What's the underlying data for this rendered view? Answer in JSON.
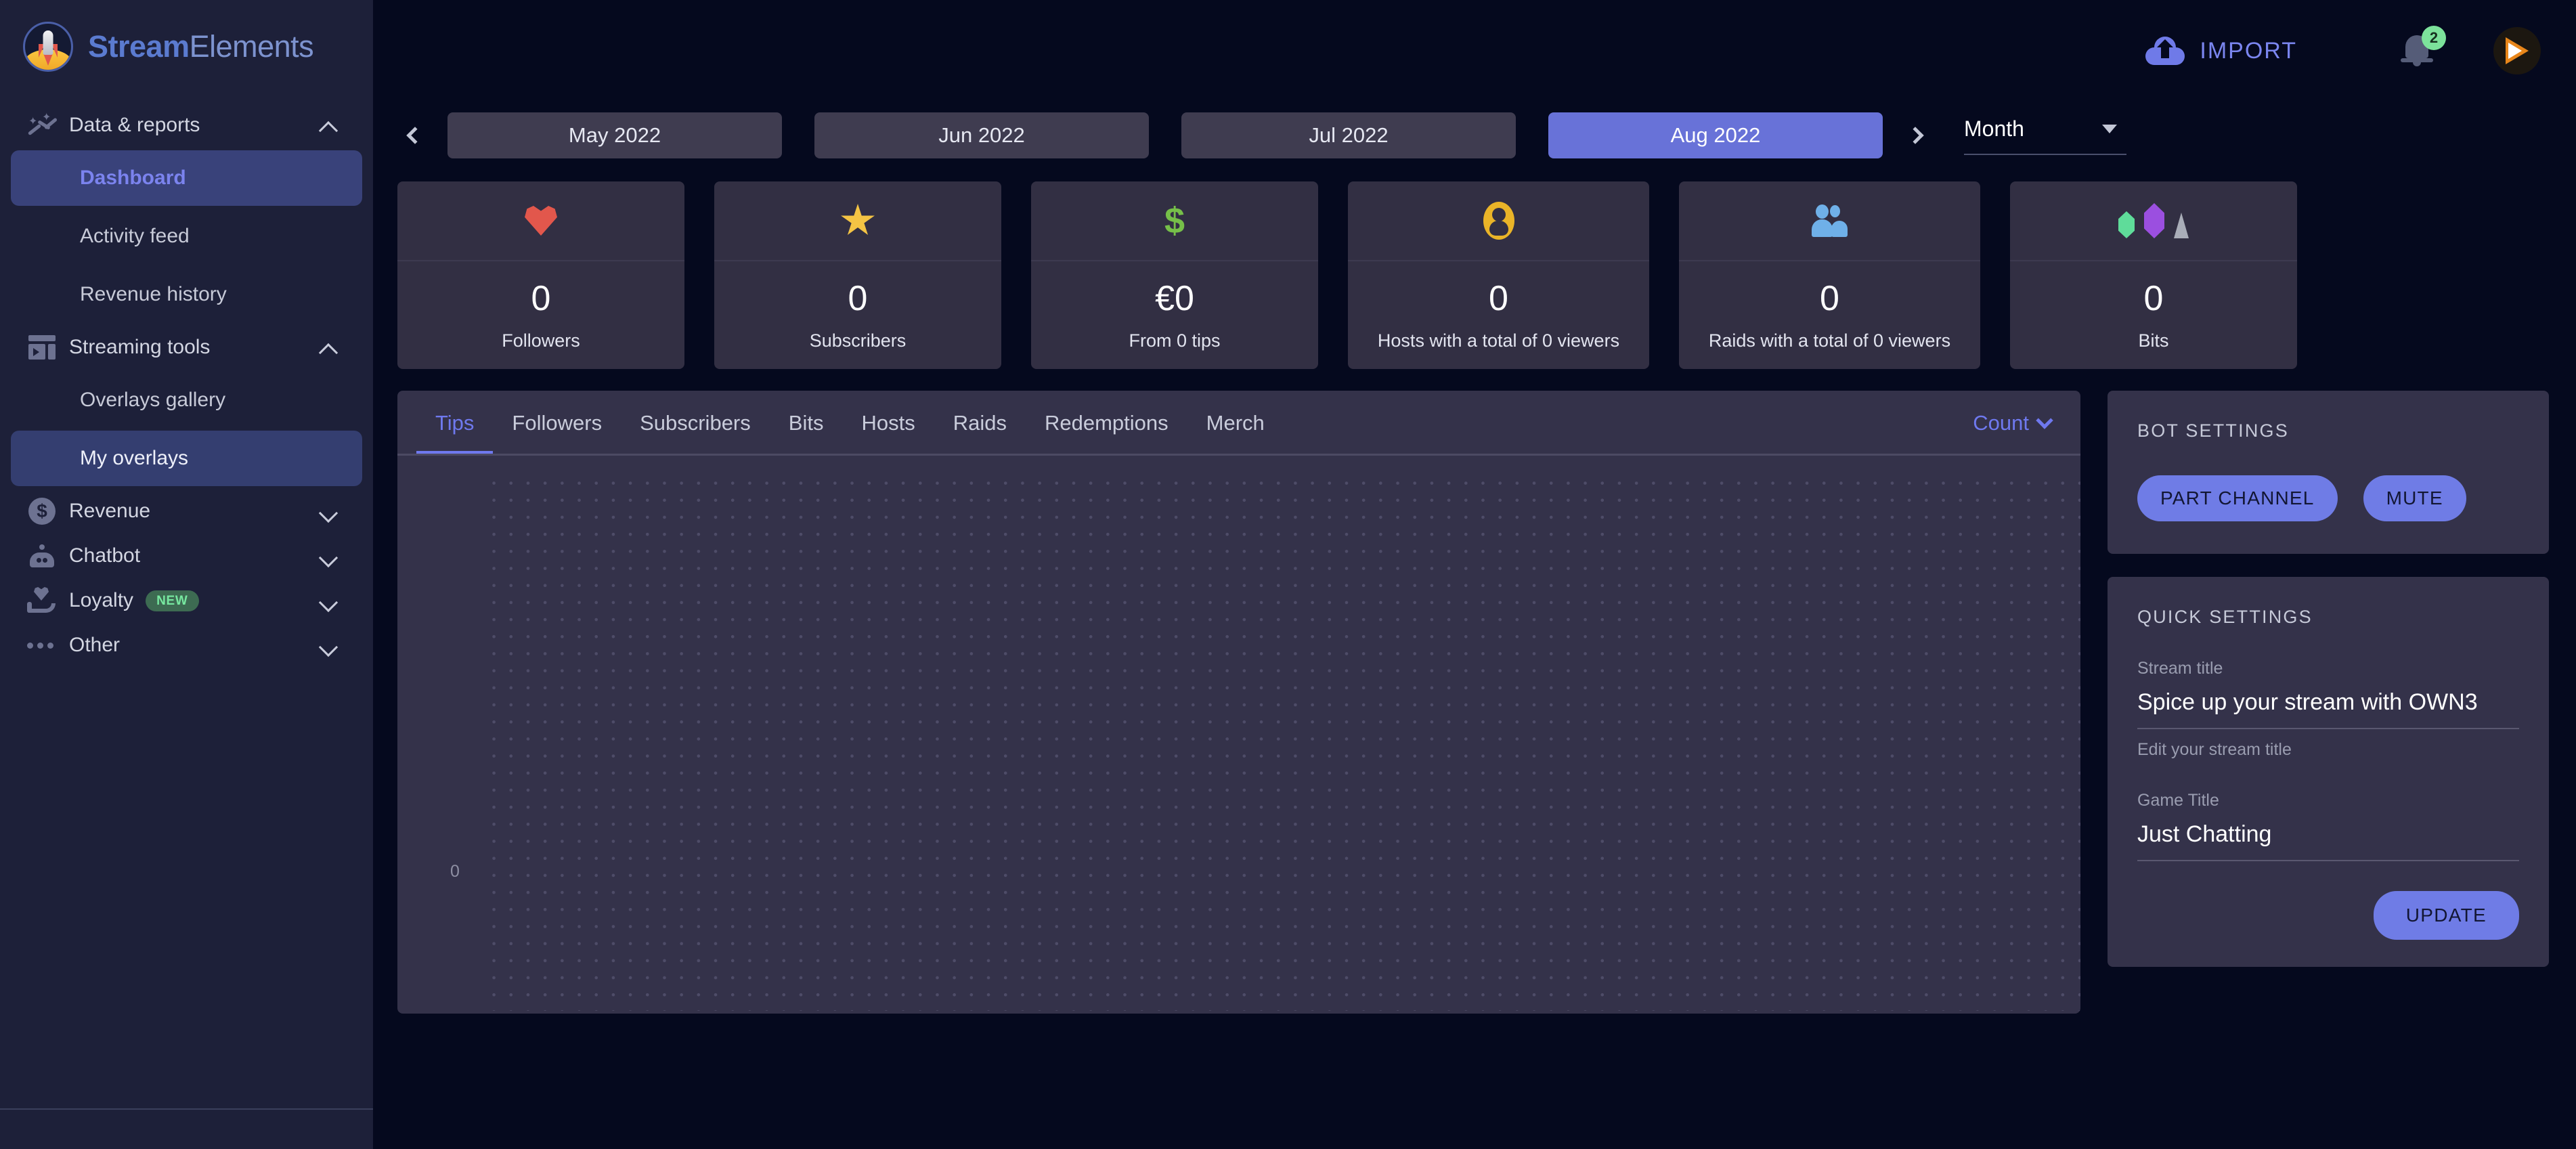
{
  "brand": {
    "name_bold": "Stream",
    "name_light": "Elements"
  },
  "topbar": {
    "import_label": "IMPORT",
    "notification_count": "2"
  },
  "sidebar": {
    "groups": [
      {
        "label": "Data & reports",
        "icon": "trend-icon",
        "expanded": true
      },
      {
        "label": "Streaming tools",
        "icon": "panel-icon",
        "expanded": true
      },
      {
        "label": "Revenue",
        "icon": "dollar-circle-icon",
        "expanded": false
      },
      {
        "label": "Chatbot",
        "icon": "robot-icon",
        "expanded": false
      },
      {
        "label": "Loyalty",
        "icon": "hand-heart-icon",
        "expanded": false,
        "badge": "NEW"
      },
      {
        "label": "Other",
        "icon": "ellipsis-icon",
        "expanded": false
      }
    ],
    "items": {
      "dashboard": "Dashboard",
      "activity_feed": "Activity feed",
      "revenue_history": "Revenue history",
      "overlays_gallery": "Overlays gallery",
      "my_overlays": "My overlays"
    }
  },
  "period": {
    "months": [
      {
        "label": "May 2022",
        "selected": false
      },
      {
        "label": "Jun 2022",
        "selected": false
      },
      {
        "label": "Jul 2022",
        "selected": false
      },
      {
        "label": "Aug 2022",
        "selected": true
      }
    ],
    "granularity": "Month"
  },
  "stats": [
    {
      "icon": "heart-icon",
      "value": "0",
      "label": "Followers"
    },
    {
      "icon": "star-icon",
      "value": "0",
      "label": "Subscribers"
    },
    {
      "icon": "dollar-icon",
      "value": "€0",
      "label": "From 0 tips"
    },
    {
      "icon": "person-icon",
      "value": "0",
      "label": "Hosts with a total of 0 viewers"
    },
    {
      "icon": "people-icon",
      "value": "0",
      "label": "Raids with a total of 0 viewers"
    },
    {
      "icon": "gems-icon",
      "value": "0",
      "label": "Bits"
    }
  ],
  "chart_panel": {
    "tabs": [
      {
        "label": "Tips",
        "active": true
      },
      {
        "label": "Followers",
        "active": false
      },
      {
        "label": "Subscribers",
        "active": false
      },
      {
        "label": "Bits",
        "active": false
      },
      {
        "label": "Hosts",
        "active": false
      },
      {
        "label": "Raids",
        "active": false
      },
      {
        "label": "Redemptions",
        "active": false
      },
      {
        "label": "Merch",
        "active": false
      }
    ],
    "metric_select": "Count"
  },
  "chart_data": {
    "type": "line",
    "title": "Tips",
    "series": [
      {
        "name": "Count",
        "values": []
      }
    ],
    "x": [],
    "xlabel": "",
    "ylabel": "",
    "ytick_labels": [
      "0"
    ],
    "ylim": [
      0,
      0
    ],
    "grid": "dotted",
    "legend": "none",
    "note": "Empty chart — no data points plotted for Aug 2022"
  },
  "bot_settings": {
    "title": "BOT SETTINGS",
    "part_channel": "PART CHANNEL",
    "mute": "MUTE"
  },
  "quick_settings": {
    "title": "QUICK SETTINGS",
    "stream_title_label": "Stream title",
    "stream_title_value": "Spice up your stream with OWN3",
    "stream_title_hint": "Edit your stream title",
    "game_title_label": "Game Title",
    "game_title_value": "Just Chatting",
    "update": "UPDATE"
  },
  "colors": {
    "accent": "#6f79ef",
    "sidebar_bg": "#1d2039",
    "main_bg": "#05091e",
    "panel_bg": "#34324a",
    "card_bg": "#322f43",
    "badge_green": "#7ce29b"
  }
}
